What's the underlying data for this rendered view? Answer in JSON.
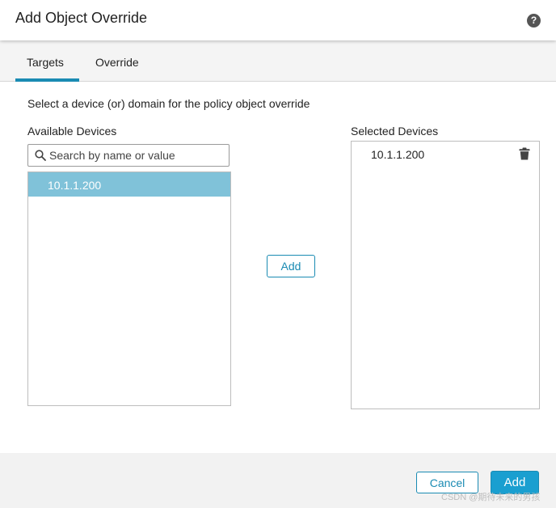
{
  "dialog": {
    "title": "Add Object Override",
    "help_icon": "help-icon",
    "help_glyph": "?"
  },
  "tabs": [
    {
      "label": "Targets",
      "active": true
    },
    {
      "label": "Override",
      "active": false
    }
  ],
  "instruction": "Select a device (or) domain for the policy object override",
  "available": {
    "label": "Available Devices",
    "search_placeholder": "Search by name or value",
    "items": [
      {
        "label": "10.1.1.200",
        "selected": true
      }
    ]
  },
  "add_middle_label": "Add",
  "selected": {
    "label": "Selected Devices",
    "items": [
      {
        "label": "10.1.1.200",
        "icon": "trash-icon"
      }
    ]
  },
  "footer": {
    "cancel_label": "Cancel",
    "add_label": "Add",
    "watermark": "CSDN @期待未来的男孩"
  },
  "colors": {
    "accent": "#1a8bb3",
    "primary_button": "#1a9fd0",
    "selected_row": "#80c2d9",
    "footer_bg": "#f2f2f2"
  }
}
